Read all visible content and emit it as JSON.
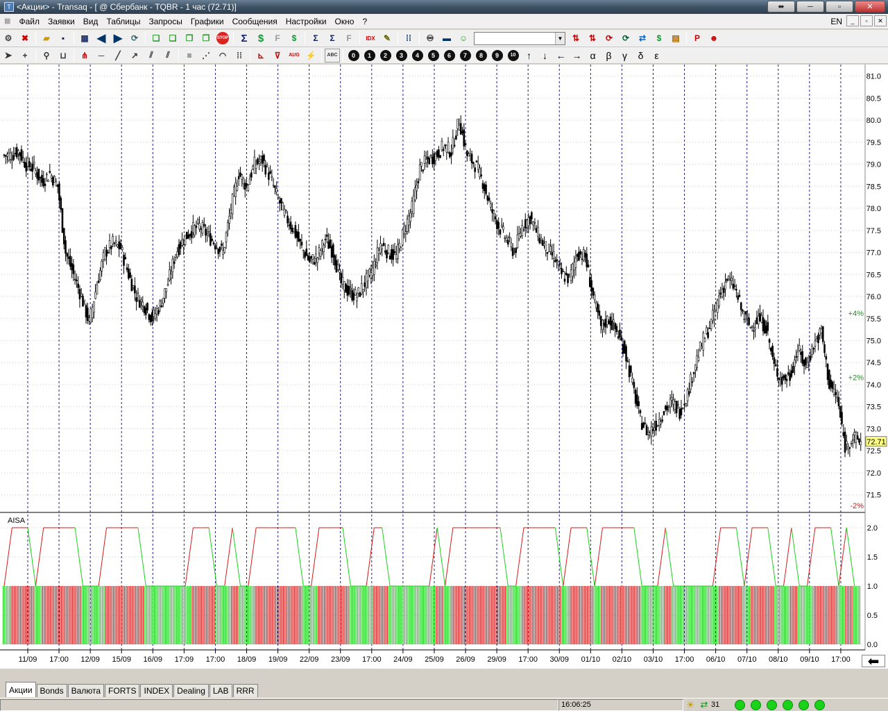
{
  "window": {
    "title": "<Акции> - Transaq - [ @ Сбербанк - TQBR - 1 час (72.71)]",
    "buttons": {
      "minimize": "⬌",
      "maximize": "─",
      "restore": "▫",
      "close": "✕"
    }
  },
  "menu": {
    "items": [
      "Файл",
      "Заявки",
      "Вид",
      "Таблицы",
      "Запросы",
      "Графики",
      "Сообщения",
      "Настройки",
      "Окно",
      "?"
    ],
    "lang": "EN"
  },
  "toolbar1": {
    "icons": [
      "new-order-icon",
      "delete-icon",
      "open-folder-icon",
      "save-icon",
      "table-icon",
      "arrow-left-icon",
      "arrow-right-icon",
      "refresh-icon",
      "copy-icon",
      "copy2-icon",
      "paste-icon",
      "paste2-icon",
      "stop-icon",
      "sigma-icon",
      "dollar-icon",
      "fs-icon",
      "dollar-cycle-icon",
      "sigma-p-icon",
      "sigma-l-icon",
      "fl-icon",
      "idx-icon",
      "edit-icon",
      "ticker-icon",
      "binoculars-icon",
      "ruler-icon",
      "people-icon"
    ],
    "combo_value": "",
    "right_icons": [
      "red-arrows-icon",
      "red-arrows2-icon",
      "cycle-icon",
      "chart-cycle-icon",
      "swap-icon",
      "dollar-swap-icon",
      "report-icon",
      "p-icon",
      "mask-icon"
    ]
  },
  "toolbar2": {
    "tools": [
      "pointer-icon",
      "crosshair-icon",
      "zoom-icon",
      "ruler-icon",
      "fork-icon",
      "hline-icon",
      "line-icon",
      "ray-icon",
      "parallel-icon",
      "channel-icon",
      "fibo-icon",
      "fibo-fan-icon",
      "arcs-icon",
      "time-icon",
      "regress-icon",
      "cycles-icon",
      "aug-icon",
      "elliott-icon",
      "text-icon"
    ],
    "numbered": [
      "0",
      "1",
      "2",
      "3",
      "4",
      "5",
      "6",
      "7",
      "8",
      "9",
      "10"
    ],
    "arrows": [
      "↑",
      "↓",
      "←",
      "→"
    ],
    "greek": [
      "α",
      "β",
      "γ",
      "δ",
      "ε"
    ]
  },
  "chart": {
    "price_labels": [
      "81.0",
      "80.5",
      "80.0",
      "79.5",
      "79.0",
      "78.5",
      "78.0",
      "77.5",
      "77.0",
      "76.5",
      "76.0",
      "75.5",
      "75.0",
      "74.5",
      "74.0",
      "73.5",
      "73.0",
      "72.5",
      "72.0",
      "71.5"
    ],
    "current_price": "72.71",
    "pct_labels": [
      {
        "text": "+4%",
        "color": "#2a8a2a"
      },
      {
        "text": "+2%",
        "color": "#2a8a2a"
      },
      {
        "text": "-2%",
        "color": "#b52020"
      }
    ],
    "indicator_name": "AISA",
    "indicator_labels": [
      "2.0",
      "1.5",
      "1.0",
      "0.5",
      "0.0"
    ],
    "date_labels": [
      "11/09",
      "17:00",
      "12/09",
      "15/09",
      "16/09",
      "17:09",
      "17:00",
      "18/09",
      "19/09",
      "22/09",
      "23/09",
      "17:00",
      "24/09",
      "25/09",
      "26/09",
      "29/09",
      "17:00",
      "30/09",
      "01/10",
      "02/10",
      "03/10",
      "17:00",
      "06/10",
      "07/10",
      "08/10",
      "09/10",
      "17:00"
    ],
    "colors": {
      "green": "#19d219",
      "red": "#d41a1a",
      "grid": "#cfcfcf",
      "day_line": "#1a1a9e"
    }
  },
  "chart_data": {
    "type": "candlestick",
    "title": "",
    "ylim": [
      71.1,
      81.2
    ],
    "closes": [
      79.2,
      79.3,
      79.0,
      78.9,
      78.6,
      78.8,
      78.5,
      77.0,
      76.5,
      76.0,
      75.4,
      76.3,
      77.0,
      77.2,
      77.1,
      76.5,
      76.0,
      75.8,
      75.5,
      75.8,
      76.3,
      77.0,
      77.3,
      77.5,
      77.6,
      77.4,
      77.2,
      77.0,
      78.0,
      78.8,
      78.5,
      79.0,
      79.1,
      78.7,
      78.2,
      77.8,
      77.5,
      77.1,
      76.8,
      76.9,
      77.3,
      77.0,
      76.3,
      76.1,
      76.0,
      76.3,
      76.6,
      77.2,
      77.0,
      76.9,
      77.5,
      78.0,
      78.9,
      79.1,
      79.2,
      79.4,
      79.3,
      80.0,
      79.2,
      79.0,
      78.6,
      78.0,
      77.6,
      77.3,
      77.0,
      77.6,
      77.8,
      77.4,
      77.1,
      76.9,
      76.5,
      76.4,
      77.0,
      76.9,
      76.0,
      75.3,
      75.5,
      75.2,
      74.8,
      74.0,
      73.2,
      72.9,
      73.1,
      73.4,
      73.6,
      73.4,
      73.8,
      74.5,
      75.0,
      75.4,
      76.0,
      76.4,
      76.2,
      75.6,
      75.3,
      75.5,
      75.3,
      74.4,
      74.1,
      74.2,
      74.8,
      74.4,
      74.9,
      75.2,
      74.0,
      73.7,
      72.6,
      72.8,
      72.71
    ]
  },
  "tabs": [
    "Акции",
    "Bonds",
    "Валюта",
    "FORTS",
    "INDEX",
    "Dealing",
    "LAB",
    "RRR"
  ],
  "status": {
    "time": "16:06:25",
    "count": "31"
  }
}
